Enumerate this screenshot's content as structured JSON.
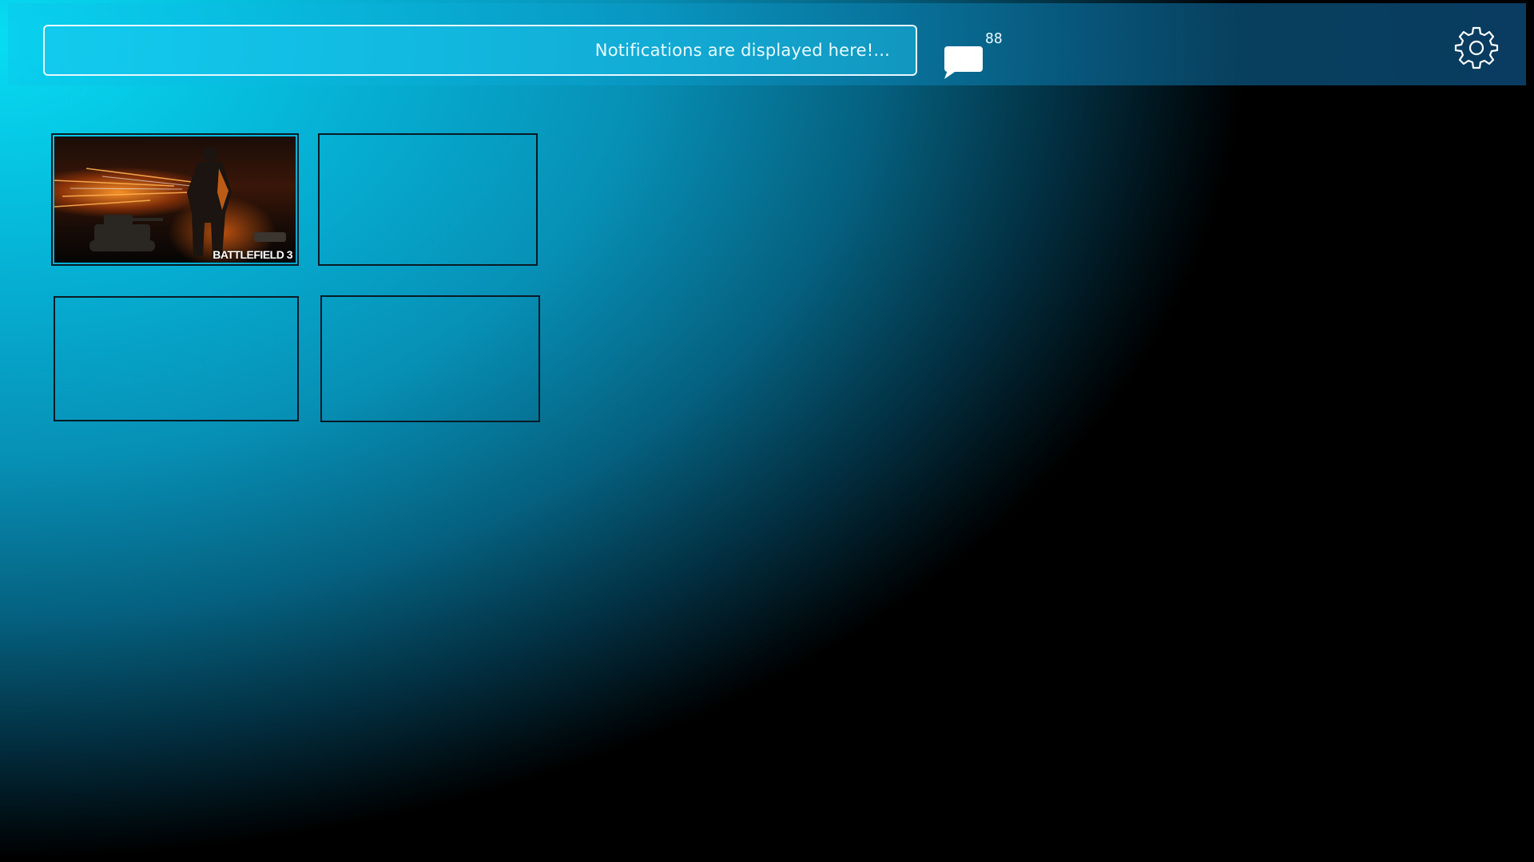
{
  "header": {
    "notification_text": "Notifications are displayed here!...",
    "message_count": "88",
    "icons": {
      "messages": "chat-bubble-icon",
      "settings": "gear-icon"
    }
  },
  "tiles": [
    {
      "title": "BATTLEFIELD 3",
      "has_art": true
    },
    {
      "title": "",
      "has_art": false
    },
    {
      "title": "",
      "has_art": false
    },
    {
      "title": "",
      "has_art": false
    }
  ],
  "colors": {
    "background_glow": "#07dcf4",
    "background_dark": "#000000",
    "text": "#e9fbff",
    "tile_border": "#0a1a24",
    "art_fire": "#ff8c1a"
  }
}
